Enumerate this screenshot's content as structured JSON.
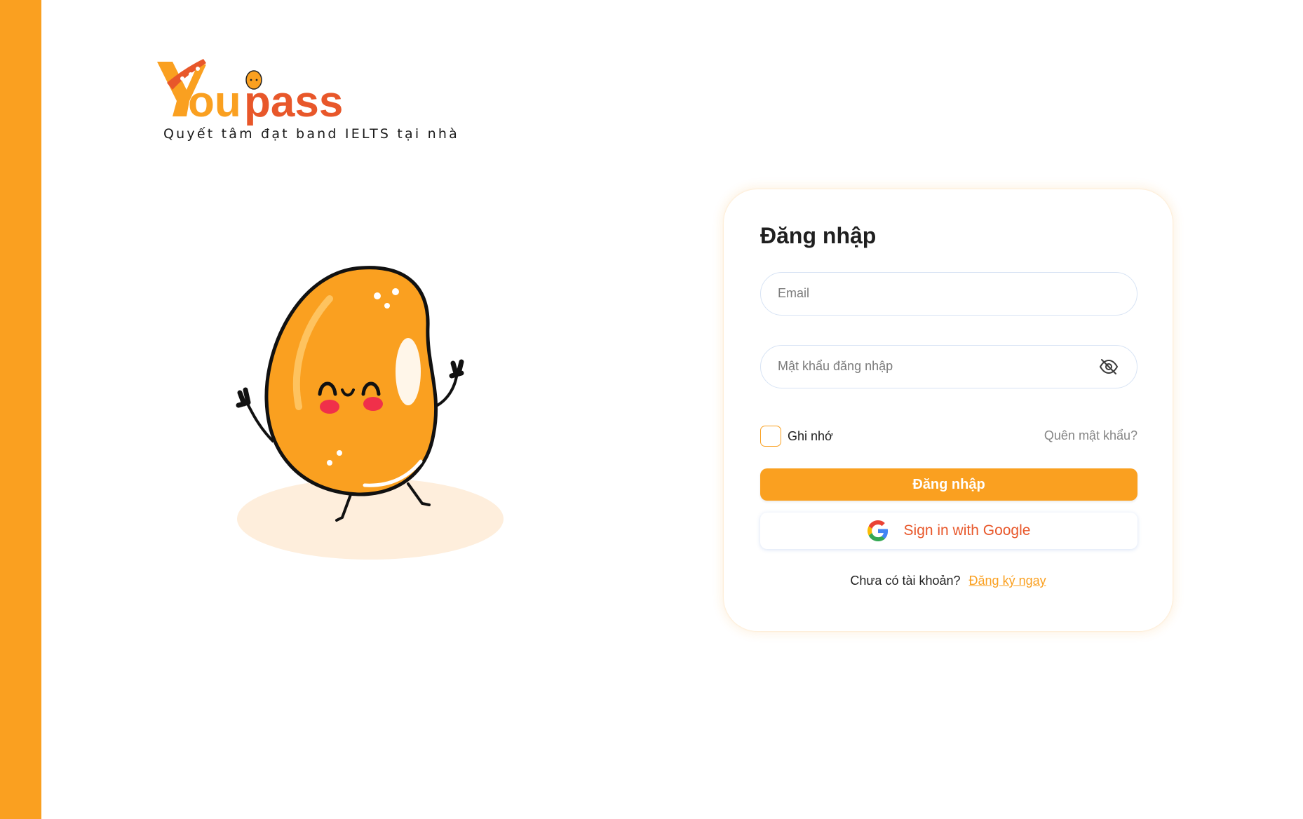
{
  "brand": {
    "name": "Youpass",
    "tagline": "Quyết tâm đạt band IELTS tại nhà",
    "primary_color": "#FAA020",
    "accent_color": "#E8572A"
  },
  "login": {
    "title": "Đăng nhập",
    "email_placeholder": "Email",
    "password_placeholder": "Mật khẩu đăng nhập",
    "remember_label": "Ghi nhớ",
    "remember_checked": false,
    "forgot_label": "Quên mật khẩu?",
    "submit_label": "Đăng nhập",
    "google_label": "Sign in with Google",
    "signup_prompt": "Chưa có tài khoản?",
    "signup_link": "Đăng ký ngay"
  },
  "icons": {
    "password_toggle": "eye-off-icon",
    "google": "google-logo-icon"
  }
}
